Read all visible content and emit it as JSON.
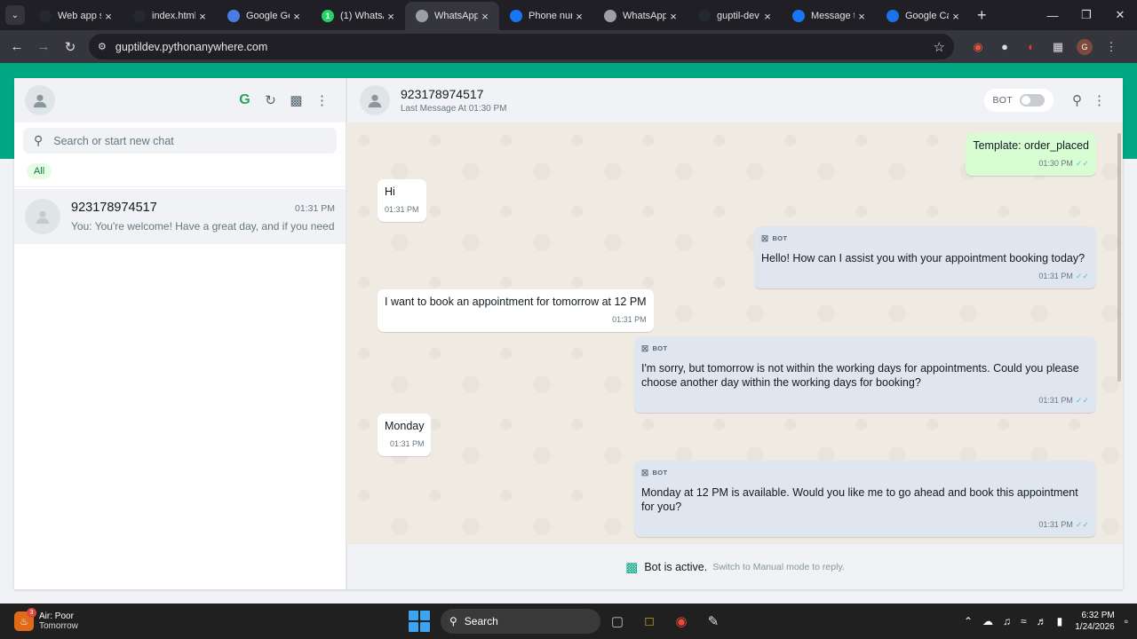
{
  "browser": {
    "tabs": [
      {
        "label": "Web app s",
        "favicon": "github-icon",
        "color": "#24292f"
      },
      {
        "label": "index.html",
        "favicon": "github-icon",
        "color": "#24292f"
      },
      {
        "label": "Google Ge",
        "favicon": "gemini-icon",
        "color": "#4b7be5"
      },
      {
        "label": "(1) WhatsA",
        "favicon": "whatsapp-icon",
        "color": "#25d366",
        "badge": "1"
      },
      {
        "label": "WhatsApp",
        "favicon": "globe-icon",
        "color": "#9aa0a6",
        "active": true
      },
      {
        "label": "Phone nun",
        "favicon": "meta-icon",
        "color": "#1877f2"
      },
      {
        "label": "WhatsApp",
        "favicon": "globe-icon",
        "color": "#9aa0a6"
      },
      {
        "label": "guptil-dev",
        "favicon": "github-icon",
        "color": "#24292f"
      },
      {
        "label": "Message t",
        "favicon": "meta-icon",
        "color": "#1877f2"
      },
      {
        "label": "Google Ca",
        "favicon": "calendar-icon",
        "color": "#1a73e8"
      }
    ],
    "url": "guptildev.pythonanywhere.com",
    "profile_initial": "G"
  },
  "sidebar": {
    "search_placeholder": "Search or start new chat",
    "filter_all": "All",
    "g_icon_label": "G",
    "chats": [
      {
        "name": "923178974517",
        "time": "01:31 PM",
        "preview": "You: You're welcome! Have a great day, and if you need anything else, feel free to reach out."
      }
    ]
  },
  "chat": {
    "contact_name": "923178974517",
    "last_message": "Last Message At 01:30 PM",
    "bot_toggle_label": "BOT",
    "bot_enabled": false,
    "messages": [
      {
        "type": "out-tpl",
        "text": "Template: order_placed",
        "time": "01:30 PM"
      },
      {
        "type": "in",
        "text": "Hi",
        "time": "01:31 PM"
      },
      {
        "type": "bot",
        "tag": "BOT",
        "text": "Hello! How can I assist you with your appointment booking today?",
        "time": "01:31 PM"
      },
      {
        "type": "in",
        "text": "I want to book an appointment for tomorrow at 12 PM",
        "time": "01:31 PM"
      },
      {
        "type": "bot",
        "tag": "BOT",
        "text": "I'm sorry, but tomorrow is not within the working days for appointments. Could you please choose another day within the working days for booking?",
        "time": "01:31 PM"
      },
      {
        "type": "in",
        "text": "Monday",
        "time": "01:31 PM"
      },
      {
        "type": "bot",
        "tag": "BOT",
        "text": "Monday at 12 PM is available. Would you like me to go ahead and book this appointment for you?",
        "time": "01:31 PM"
      }
    ],
    "footer_status": "Bot is active.",
    "footer_hint": "Switch to Manual mode to reply."
  },
  "taskbar": {
    "weather_line1": "Air: Poor",
    "weather_line2": "Tomorrow",
    "weather_badge": "3",
    "search_label": "Search",
    "time": "6:32 PM",
    "date": "1/24/2026"
  }
}
